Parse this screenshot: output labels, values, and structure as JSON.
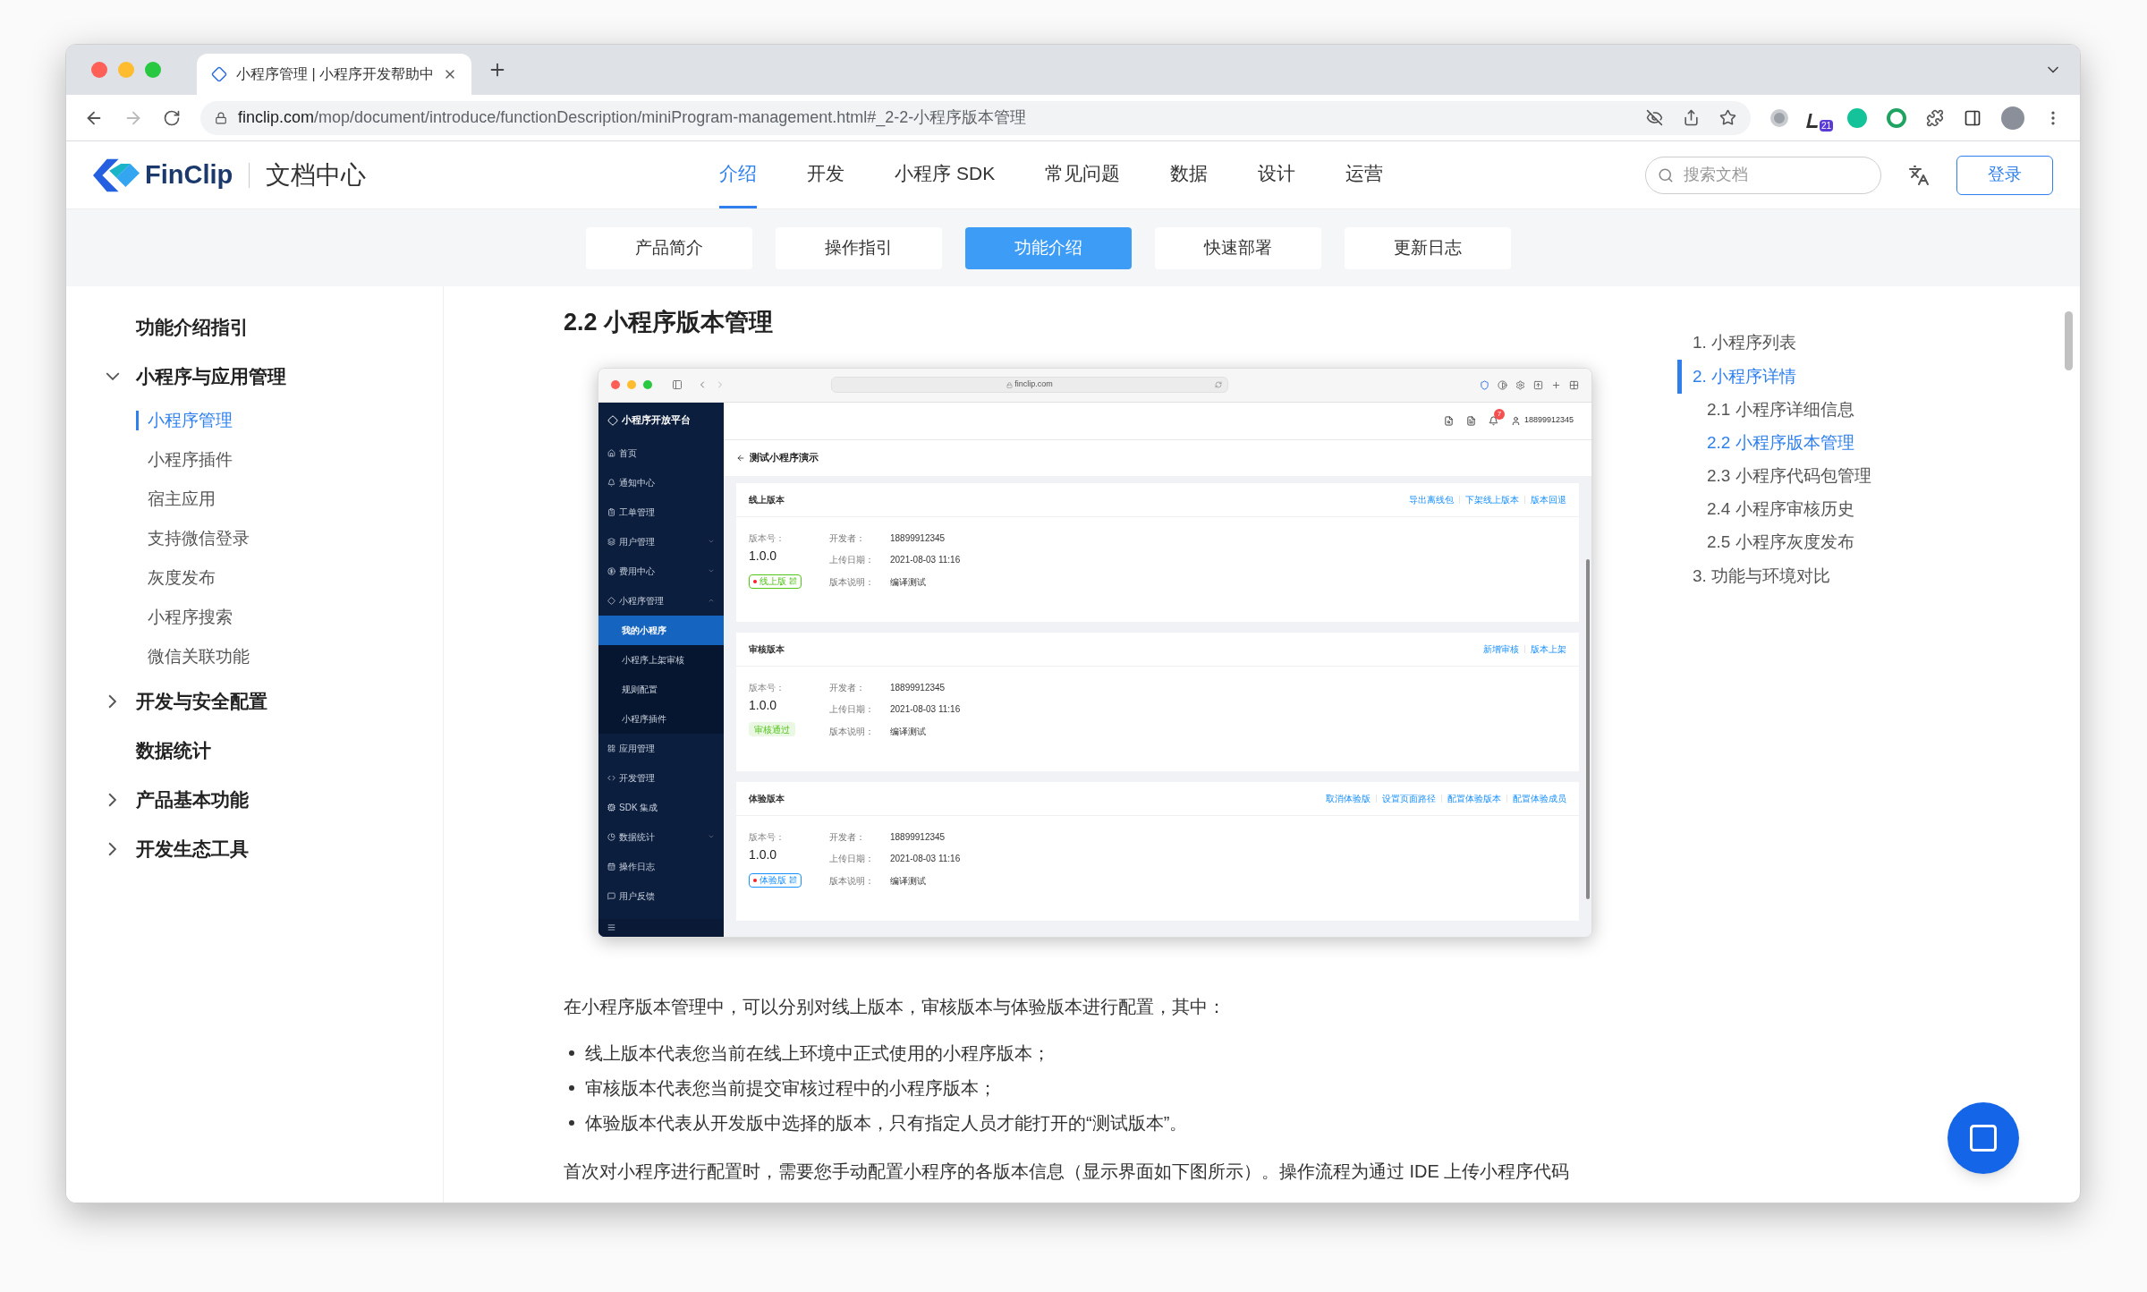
{
  "browser": {
    "tab_title": "小程序管理 | 小程序开发帮助中",
    "url_host": "finclip.com",
    "url_path": "/mop/document/introduce/functionDescription/miniProgram-management.html#_2-2-小程序版本管理",
    "extension_badge": "21"
  },
  "site_header": {
    "logo_text": "FinClip",
    "site_name": "文档中心",
    "nav": [
      {
        "label": "介绍",
        "selected": true
      },
      {
        "label": "开发",
        "selected": false
      },
      {
        "label": "小程序 SDK",
        "selected": false
      },
      {
        "label": "常见问题",
        "selected": false
      },
      {
        "label": "数据",
        "selected": false
      },
      {
        "label": "设计",
        "selected": false
      },
      {
        "label": "运营",
        "selected": false
      }
    ],
    "search": {
      "placeholder": "搜索文档"
    },
    "login": "登录"
  },
  "sub_tabs": [
    {
      "label": "产品简介",
      "selected": false
    },
    {
      "label": "操作指引",
      "selected": false
    },
    {
      "label": "功能介绍",
      "selected": true
    },
    {
      "label": "快速部署",
      "selected": false
    },
    {
      "label": "更新日志",
      "selected": false
    }
  ],
  "sidebar": {
    "items": [
      {
        "label": "功能介绍指引",
        "kind": "link"
      },
      {
        "label": "小程序与应用管理",
        "kind": "group",
        "expanded": true,
        "children": [
          {
            "label": "小程序管理",
            "selected": true
          },
          {
            "label": "小程序插件",
            "selected": false
          },
          {
            "label": "宿主应用",
            "selected": false
          },
          {
            "label": "支持微信登录",
            "selected": false
          },
          {
            "label": "灰度发布",
            "selected": false
          },
          {
            "label": "小程序搜索",
            "selected": false
          },
          {
            "label": "微信关联功能",
            "selected": false
          }
        ]
      },
      {
        "label": "开发与安全配置",
        "kind": "group",
        "expanded": false
      },
      {
        "label": "数据统计",
        "kind": "link"
      },
      {
        "label": "产品基本功能",
        "kind": "group",
        "expanded": false
      },
      {
        "label": "开发生态工具",
        "kind": "group",
        "expanded": false
      }
    ]
  },
  "article": {
    "heading": "2.2 小程序版本管理",
    "screenshot": {
      "url": "finclip.com",
      "platform_name": "小程序开放平台",
      "menu": [
        {
          "label": "首页",
          "kind": "item"
        },
        {
          "label": "通知中心",
          "kind": "item"
        },
        {
          "label": "工单管理",
          "kind": "item"
        },
        {
          "label": "用户管理",
          "kind": "group",
          "expanded": false
        },
        {
          "label": "费用中心",
          "kind": "group",
          "expanded": false
        },
        {
          "label": "小程序管理",
          "kind": "group",
          "expanded": true,
          "children": [
            {
              "label": "我的小程序",
              "selected": true
            },
            {
              "label": "小程序上架审核",
              "selected": false
            },
            {
              "label": "规则配置",
              "selected": false
            },
            {
              "label": "小程序插件",
              "selected": false
            }
          ]
        },
        {
          "label": "应用管理",
          "kind": "item"
        },
        {
          "label": "开发管理",
          "kind": "item"
        },
        {
          "label": "SDK 集成",
          "kind": "item"
        },
        {
          "label": "数据统计",
          "kind": "group",
          "expanded": false
        },
        {
          "label": "操作日志",
          "kind": "item"
        },
        {
          "label": "用户反馈",
          "kind": "item"
        }
      ],
      "notification_count": "7",
      "user": "18899912345",
      "page_title": "测试小程序演示",
      "cards": [
        {
          "title": "线上版本",
          "actions": [
            "导出离线包",
            "下架线上版本",
            "版本回退"
          ],
          "version_label": "版本号：",
          "version": "1.0.0",
          "status": {
            "label": "线上版",
            "kind": "online"
          },
          "fields": [
            {
              "label": "开发者：",
              "value": "18899912345"
            },
            {
              "label": "上传日期：",
              "value": "2021-08-03 11:16"
            },
            {
              "label": "版本说明：",
              "value": "编译测试"
            }
          ]
        },
        {
          "title": "审核版本",
          "actions": [
            "新增审核",
            "版本上架"
          ],
          "version_label": "版本号：",
          "version": "1.0.0",
          "status": {
            "label": "审核通过",
            "kind": "approved"
          },
          "fields": [
            {
              "label": "开发者：",
              "value": "18899912345"
            },
            {
              "label": "上传日期：",
              "value": "2021-08-03 11:16"
            },
            {
              "label": "版本说明：",
              "value": "编译测试"
            }
          ]
        },
        {
          "title": "体验版本",
          "actions": [
            "取消体验版",
            "设置页面路径",
            "配置体验版本",
            "配置体验成员"
          ],
          "version_label": "版本号：",
          "version": "1.0.0",
          "status": {
            "label": "体验版",
            "kind": "trial"
          },
          "fields": [
            {
              "label": "开发者：",
              "value": "18899912345"
            },
            {
              "label": "上传日期：",
              "value": "2021-08-03 11:16"
            },
            {
              "label": "版本说明：",
              "value": "编译测试"
            }
          ]
        }
      ]
    },
    "intro": "在小程序版本管理中，可以分别对线上版本，审核版本与体验版本进行配置，其中：",
    "bullets": [
      "线上版本代表您当前在线上环境中正式使用的小程序版本；",
      "审核版本代表您当前提交审核过程中的小程序版本；",
      "体验版本代表从开发版中选择的版本，只有指定人员才能打开的“测试版本”。"
    ],
    "paragraph": "首次对小程序进行配置时，需要您手动配置小程序的各版本信息（显示界面如下图所示）。操作流程为通过 IDE 上传小程序代码"
  },
  "toc": [
    {
      "label": "1. 小程序列表",
      "selected": false
    },
    {
      "label": "2. 小程序详情",
      "selected": true,
      "children": [
        {
          "label": "2.1 小程序详细信息",
          "selected": false
        },
        {
          "label": "2.2 小程序版本管理",
          "selected": true
        },
        {
          "label": "2.3 小程序代码包管理",
          "selected": false
        },
        {
          "label": "2.4 小程序审核历史",
          "selected": false
        },
        {
          "label": "2.5 小程序灰度发布",
          "selected": false
        }
      ]
    },
    {
      "label": "3. 功能与环境对比",
      "selected": false
    }
  ]
}
